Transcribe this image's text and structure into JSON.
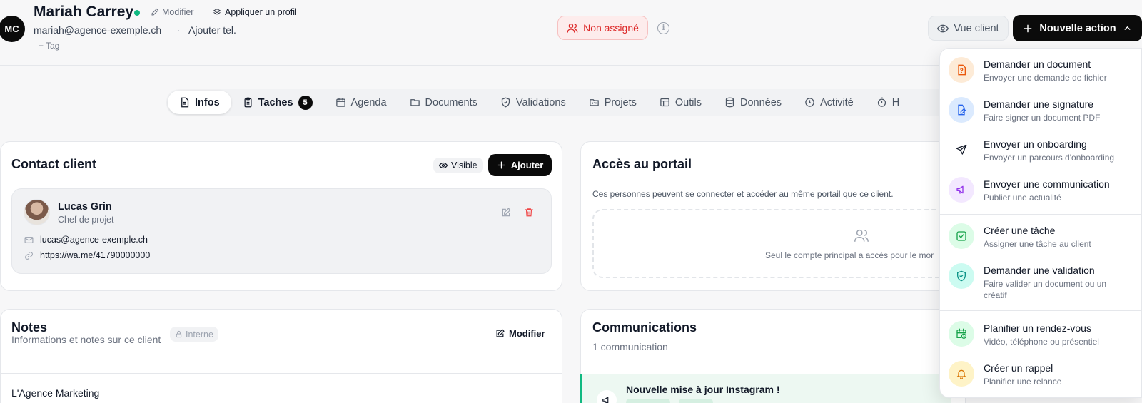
{
  "header": {
    "avatar_initials": "MC",
    "client_name": "Mariah Carrey",
    "modifier_label": "Modifier",
    "apply_profile_label": "Appliquer un profil",
    "email": "mariah@agence-exemple.ch",
    "add_phone_label": "Ajouter tel.",
    "add_tag_label": "+ Tag",
    "assignment_label": "Non assigné",
    "client_view_label": "Vue client",
    "new_action_label": "Nouvelle action",
    "status_color": "#10b981",
    "accent_color": "#0b0b0b"
  },
  "tabs": [
    {
      "label": "Infos",
      "icon": "document-icon",
      "active": true
    },
    {
      "label": "Taches",
      "icon": "clipboard-icon",
      "badge": "5"
    },
    {
      "label": "Agenda",
      "icon": "calendar-icon"
    },
    {
      "label": "Documents",
      "icon": "folder-icon"
    },
    {
      "label": "Validations",
      "icon": "shield-check-icon"
    },
    {
      "label": "Projets",
      "icon": "kanban-icon"
    },
    {
      "label": "Outils",
      "icon": "window-icon"
    },
    {
      "label": "Données",
      "icon": "database-icon"
    },
    {
      "label": "Activité",
      "icon": "clock-icon"
    },
    {
      "label": "H",
      "icon": "timer-icon"
    }
  ],
  "contact_card": {
    "title": "Contact client",
    "visible_label": "Visible",
    "add_label": "Ajouter",
    "person": {
      "name": "Lucas Grin",
      "role": "Chef de projet",
      "email": "lucas@agence-exemple.ch",
      "link": "https://wa.me/41790000000"
    }
  },
  "portal_card": {
    "title": "Accès au portail",
    "description": "Ces personnes peuvent se connecter et accéder au même portail que ce client.",
    "empty_text": "Seul le compte principal a accès pour le mor"
  },
  "notes_card": {
    "title": "Notes",
    "subtitle": "Informations et notes sur ce client",
    "internal_label": "Interne",
    "modifier_label": "Modifier",
    "content_first_line": "L'Agence Marketing"
  },
  "communications_card": {
    "title": "Communications",
    "count_text": "1 communication",
    "item_title": "Nouvelle mise à jour Instagram !"
  },
  "action_menu": {
    "items": [
      {
        "title": "Demander un document",
        "desc": "Envoyer une demande de fichier",
        "icon": "file-question-icon",
        "bg": "#fdebd7",
        "fg": "#ea580c"
      },
      {
        "title": "Demander une signature",
        "desc": "Faire signer un document PDF",
        "icon": "signature-icon",
        "bg": "#dbeafe",
        "fg": "#2563eb"
      },
      {
        "title": "Envoyer un onboarding",
        "desc": "Envoyer un parcours d'onboarding",
        "icon": "send-icon",
        "bg": "#ffffff",
        "fg": "#111827"
      },
      {
        "title": "Envoyer une communication",
        "desc": "Publier une actualité",
        "icon": "megaphone-icon",
        "bg": "#f3e8ff",
        "fg": "#9333ea"
      },
      {
        "title": "Créer une tâche",
        "desc": "Assigner une tâche au client",
        "icon": "check-square-icon",
        "bg": "#dcfce7",
        "fg": "#16a34a"
      },
      {
        "title": "Demander une validation",
        "desc": "Faire valider un document ou un créatif",
        "icon": "shield-check-icon",
        "bg": "#ccfbf1",
        "fg": "#0d9488"
      },
      {
        "title": "Planifier un rendez-vous",
        "desc": "Vidéo, téléphone ou présentiel",
        "icon": "calendar-clock-icon",
        "bg": "#dcfce7",
        "fg": "#16a34a"
      },
      {
        "title": "Créer un rappel",
        "desc": "Planifier une relance",
        "icon": "bell-icon",
        "bg": "#fef3c7",
        "fg": "#d97706"
      }
    ]
  }
}
